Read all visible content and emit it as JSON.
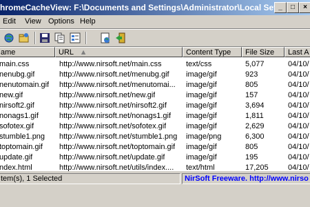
{
  "window": {
    "title": "hromeCacheView:  F:\\Documents and Settings\\Administrator\\Local Settings..."
  },
  "menu": {
    "items": [
      "Edit",
      "View",
      "Options",
      "Help"
    ]
  },
  "toolbar": {
    "icons": [
      "globe-icon",
      "open-folder-icon",
      "save-icon",
      "copy-icon",
      "properties-icon",
      "html-report-icon",
      "exit-icon"
    ]
  },
  "table": {
    "columns": [
      "ame",
      "URL",
      "Content Type",
      "File Size",
      "Last A"
    ],
    "sort_indicator": "▲",
    "rows": [
      {
        "name": "main.css",
        "url": "http://www.nirsoft.net/main.css",
        "type": "text/css",
        "size": "5,077",
        "date": "04/10/"
      },
      {
        "name": "nenubg.gif",
        "url": "http://www.nirsoft.net/menubg.gif",
        "type": "image/gif",
        "size": "923",
        "date": "04/10/"
      },
      {
        "name": "nenutomain.gif",
        "url": "http://www.nirsoft.net/menutomai...",
        "type": "image/gif",
        "size": "805",
        "date": "04/10/"
      },
      {
        "name": "new.gif",
        "url": "http://www.nirsoft.net/new.gif",
        "type": "image/gif",
        "size": "157",
        "date": "04/10/"
      },
      {
        "name": "nirsoft2.gif",
        "url": "http://www.nirsoft.net/nirsoft2.gif",
        "type": "image/gif",
        "size": "3,694",
        "date": "04/10/"
      },
      {
        "name": "nonags1.gif",
        "url": "http://www.nirsoft.net/nonags1.gif",
        "type": "image/gif",
        "size": "1,811",
        "date": "04/10/"
      },
      {
        "name": "sofotex.gif",
        "url": "http://www.nirsoft.net/sofotex.gif",
        "type": "image/gif",
        "size": "2,629",
        "date": "04/10/"
      },
      {
        "name": "stumble1.png",
        "url": "http://www.nirsoft.net/stumble1.png",
        "type": "image/png",
        "size": "6,300",
        "date": "04/10/"
      },
      {
        "name": "toptomain.gif",
        "url": "http://www.nirsoft.net/toptomain.gif",
        "type": "image/gif",
        "size": "805",
        "date": "04/10/"
      },
      {
        "name": "update.gif",
        "url": "http://www.nirsoft.net/update.gif",
        "type": "image/gif",
        "size": "195",
        "date": "04/10/"
      },
      {
        "name": "ndex.html",
        "url": "http://www.nirsoft.net/utils/index....",
        "type": "text/html",
        "size": "17,205",
        "date": "04/10/"
      }
    ]
  },
  "status": {
    "selection": "tem(s), 1 Selected",
    "credit": "NirSoft Freeware.  http://www.nirso"
  },
  "colors": {
    "title_gradient_start": "#0a246a",
    "title_gradient_end": "#a6caf0",
    "credit_text": "#0000ff"
  }
}
